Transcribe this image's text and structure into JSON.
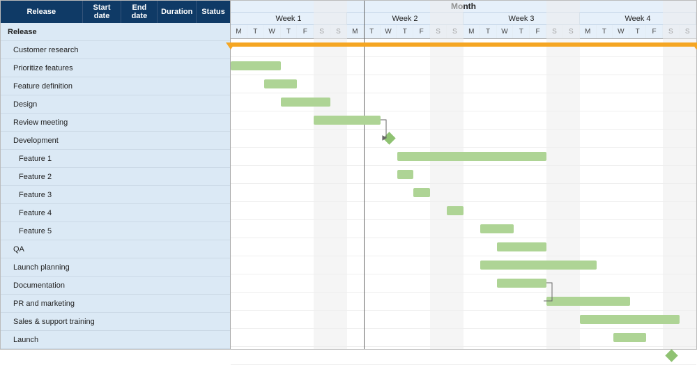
{
  "left_headers": {
    "release": "Release",
    "start": "Start date",
    "end": "End date",
    "duration": "Duration",
    "status": "Status"
  },
  "calendar": {
    "month_label": "Month",
    "weeks": [
      "Week 1",
      "Week 2",
      "Week 3",
      "Week 4"
    ],
    "day_letters": [
      "M",
      "T",
      "W",
      "T",
      "F",
      "S",
      "S",
      "M",
      "T",
      "W",
      "T",
      "F",
      "S",
      "S",
      "M",
      "T",
      "W",
      "T",
      "F",
      "S",
      "S",
      "M",
      "T",
      "W",
      "T",
      "F",
      "S",
      "S"
    ]
  },
  "tasks": [
    {
      "name": "Release",
      "indent": 0,
      "bold": true,
      "type": "summary",
      "start": 0,
      "end": 28
    },
    {
      "name": "Customer research",
      "indent": 1,
      "bold": false,
      "type": "bar",
      "start": 0,
      "end": 3
    },
    {
      "name": "Prioritize features",
      "indent": 1,
      "bold": false,
      "type": "bar",
      "start": 2,
      "end": 4
    },
    {
      "name": "Feature definition",
      "indent": 1,
      "bold": false,
      "type": "bar",
      "start": 3,
      "end": 6
    },
    {
      "name": "Design",
      "indent": 1,
      "bold": false,
      "type": "bar",
      "start": 5,
      "end": 9,
      "dep_to": 5
    },
    {
      "name": "Review meeting",
      "indent": 1,
      "bold": false,
      "type": "milestone",
      "start": 9.5
    },
    {
      "name": "Development",
      "indent": 1,
      "bold": false,
      "type": "bar",
      "start": 10,
      "end": 19
    },
    {
      "name": "Feature 1",
      "indent": 2,
      "bold": false,
      "type": "bar",
      "start": 10,
      "end": 11
    },
    {
      "name": "Feature 2",
      "indent": 2,
      "bold": false,
      "type": "bar",
      "start": 11,
      "end": 12
    },
    {
      "name": "Feature 3",
      "indent": 2,
      "bold": false,
      "type": "bar",
      "start": 13,
      "end": 14
    },
    {
      "name": "Feature 4",
      "indent": 2,
      "bold": false,
      "type": "bar",
      "start": 15,
      "end": 17
    },
    {
      "name": "Feature 5",
      "indent": 2,
      "bold": false,
      "type": "bar",
      "start": 16,
      "end": 19
    },
    {
      "name": "QA",
      "indent": 1,
      "bold": false,
      "type": "bar",
      "start": 15,
      "end": 22
    },
    {
      "name": "Launch planning",
      "indent": 1,
      "bold": false,
      "type": "bar",
      "start": 16,
      "end": 19,
      "dep_to": 14
    },
    {
      "name": "Documentation",
      "indent": 1,
      "bold": false,
      "type": "bar",
      "start": 19,
      "end": 24
    },
    {
      "name": "PR and  marketing",
      "indent": 1,
      "bold": false,
      "type": "bar",
      "start": 21,
      "end": 27
    },
    {
      "name": "Sales & support training",
      "indent": 1,
      "bold": false,
      "type": "bar",
      "start": 23,
      "end": 25
    },
    {
      "name": "Launch",
      "indent": 1,
      "bold": false,
      "type": "milestone",
      "start": 26.5
    }
  ],
  "today_day": 8,
  "chart_data": {
    "type": "gantt",
    "title": "Month",
    "x_unit": "day",
    "x_range": [
      0,
      28
    ],
    "x_day_labels": [
      "M",
      "T",
      "W",
      "T",
      "F",
      "S",
      "S",
      "M",
      "T",
      "W",
      "T",
      "F",
      "S",
      "S",
      "M",
      "T",
      "W",
      "T",
      "F",
      "S",
      "S",
      "M",
      "T",
      "W",
      "T",
      "F",
      "S",
      "S"
    ],
    "x_week_groups": [
      {
        "label": "Week 1",
        "days": [
          0,
          1,
          2,
          3,
          4,
          5,
          6
        ]
      },
      {
        "label": "Week 2",
        "days": [
          7,
          8,
          9,
          10,
          11,
          12,
          13
        ]
      },
      {
        "label": "Week 3",
        "days": [
          14,
          15,
          16,
          17,
          18,
          19,
          20
        ]
      },
      {
        "label": "Week 4",
        "days": [
          21,
          22,
          23,
          24,
          25,
          26,
          27
        ]
      }
    ],
    "weekend_days": [
      5,
      6,
      12,
      13,
      19,
      20,
      26,
      27
    ],
    "current_day_marker": 8,
    "rows": [
      {
        "name": "Release",
        "level": 0,
        "type": "summary",
        "start_day": 0,
        "end_day": 28
      },
      {
        "name": "Customer research",
        "level": 1,
        "type": "task",
        "start_day": 0,
        "end_day": 3
      },
      {
        "name": "Prioritize features",
        "level": 1,
        "type": "task",
        "start_day": 2,
        "end_day": 4
      },
      {
        "name": "Feature definition",
        "level": 1,
        "type": "task",
        "start_day": 3,
        "end_day": 6
      },
      {
        "name": "Design",
        "level": 1,
        "type": "task",
        "start_day": 5,
        "end_day": 9
      },
      {
        "name": "Review meeting",
        "level": 1,
        "type": "milestone",
        "start_day": 9.5
      },
      {
        "name": "Development",
        "level": 1,
        "type": "task",
        "start_day": 10,
        "end_day": 19
      },
      {
        "name": "Feature 1",
        "level": 2,
        "type": "task",
        "start_day": 10,
        "end_day": 11
      },
      {
        "name": "Feature 2",
        "level": 2,
        "type": "task",
        "start_day": 11,
        "end_day": 12
      },
      {
        "name": "Feature 3",
        "level": 2,
        "type": "task",
        "start_day": 13,
        "end_day": 14
      },
      {
        "name": "Feature 4",
        "level": 2,
        "type": "task",
        "start_day": 15,
        "end_day": 17
      },
      {
        "name": "Feature 5",
        "level": 2,
        "type": "task",
        "start_day": 16,
        "end_day": 19
      },
      {
        "name": "QA",
        "level": 1,
        "type": "task",
        "start_day": 15,
        "end_day": 22
      },
      {
        "name": "Launch planning",
        "level": 1,
        "type": "task",
        "start_day": 16,
        "end_day": 19
      },
      {
        "name": "Documentation",
        "level": 1,
        "type": "task",
        "start_day": 19,
        "end_day": 24
      },
      {
        "name": "PR and  marketing",
        "level": 1,
        "type": "task",
        "start_day": 21,
        "end_day": 27
      },
      {
        "name": "Sales & support training",
        "level": 1,
        "type": "task",
        "start_day": 23,
        "end_day": 25
      },
      {
        "name": "Launch",
        "level": 1,
        "type": "milestone",
        "start_day": 26.5
      }
    ],
    "dependencies": [
      {
        "from": "Design",
        "to": "Review meeting"
      },
      {
        "from": "Launch planning",
        "to": "Documentation"
      }
    ],
    "colors": {
      "summary_bar": "#f5a623",
      "task_bar": "#aed495",
      "milestone": "#8fc272",
      "header_bg": "#0f3a66",
      "left_panel_bg": "#dbe9f5"
    }
  }
}
